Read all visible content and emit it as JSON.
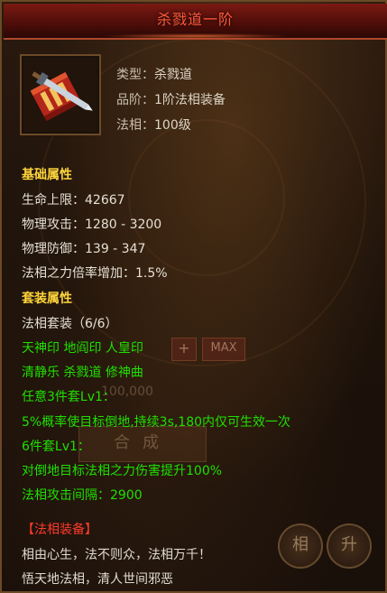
{
  "title": "杀戮道一阶",
  "item": {
    "type_label": "类型：",
    "type_value": "杀戮道",
    "grade_label": "品阶：",
    "grade_value": "1阶法相装备",
    "faxiang_label": "法相：",
    "faxiang_value": "100级"
  },
  "base_attrs": {
    "heading": "基础属性",
    "lines": [
      "生命上限：42667",
      "物理攻击：1280 - 3200",
      "物理防御：139 - 347",
      "法相之力倍率增加：1.5%"
    ]
  },
  "set_attrs": {
    "heading": "套装属性",
    "set_name": "法相套装（6/6）",
    "pieces_line1": "天神印 地阎印 人皇印",
    "pieces_line2": "清静乐 杀戮道 修神曲",
    "bonus3_label": "任意3件套Lv1：",
    "bonus3_effect": "5%概率使目标倒地,持续3s,180内仅可生效一次",
    "bonus6_label": "6件套Lv1：",
    "bonus6_effect": "对倒地目标法相之力伤害提升100%",
    "interval": "法相攻击间隔：2900"
  },
  "description": {
    "heading": "【法相装备】",
    "line1": "相由心生，法不则众，法相万千！",
    "line2": "悟天地法相，清人世间邪恶"
  },
  "background": {
    "plus_label": "+",
    "max_label": "MAX",
    "cost_value": "100,000",
    "merge_label": "合成",
    "circle_a": "相",
    "circle_b": "升"
  }
}
